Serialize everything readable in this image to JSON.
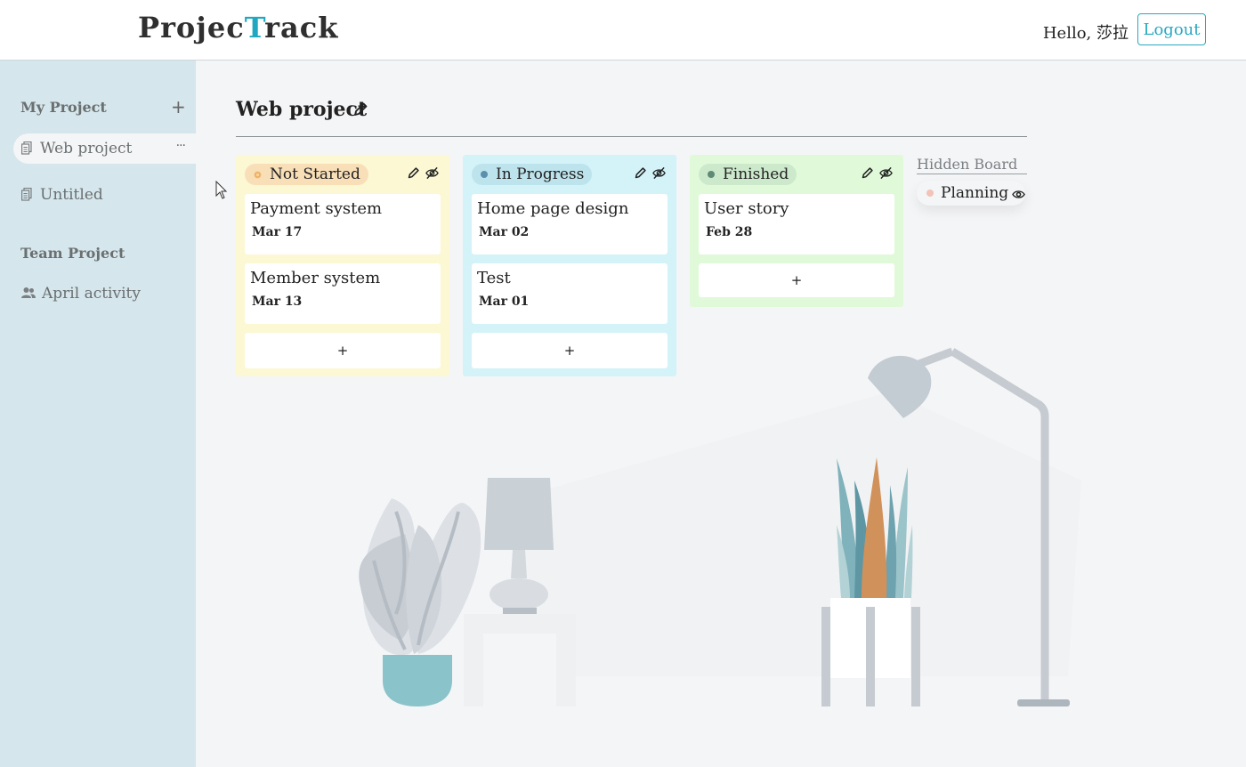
{
  "app": {
    "logo_part1": "Projec",
    "logo_accent": "T",
    "logo_part2": "rack",
    "accent_color": "#1fa8bf"
  },
  "header": {
    "greeting": "Hello, 莎拉",
    "logout_label": "Logout"
  },
  "sidebar": {
    "my_project_heading": "My Project",
    "add_icon": "+",
    "my_projects": [
      {
        "label": "Web project",
        "icon": "document-icon",
        "active": true,
        "more": "···"
      },
      {
        "label": "Untitled",
        "icon": "document-icon",
        "active": false
      }
    ],
    "team_project_heading": "Team Project",
    "team_projects": [
      {
        "label": "April activity",
        "icon": "users-icon"
      }
    ]
  },
  "main": {
    "project_title": "Web project",
    "boards": [
      {
        "status": "Not Started",
        "color": "#fbf8d3",
        "pill_color": "#f8dfb7",
        "dot_color": "#f2a64c",
        "cards": [
          {
            "title": "Payment system",
            "date": "Mar 17"
          },
          {
            "title": "Member system",
            "date": "Mar 13"
          }
        ],
        "add_label": "+"
      },
      {
        "status": "In Progress",
        "color": "#d3f3f8",
        "pill_color": "#bde3ec",
        "dot_color": "#5b8fae",
        "cards": [
          {
            "title": "Home page design",
            "date": "Mar 02"
          },
          {
            "title": "Test",
            "date": "Mar 01"
          }
        ],
        "add_label": "+"
      },
      {
        "status": "Finished",
        "color": "#e0fad9",
        "pill_color": "#cde9cc",
        "dot_color": "#5f8a75",
        "cards": [
          {
            "title": "User story",
            "date": "Feb 28"
          }
        ],
        "add_label": "+"
      }
    ],
    "hidden_board": {
      "heading": "Hidden Board",
      "items": [
        {
          "status": "Planning",
          "icon": "eye-icon"
        }
      ]
    }
  }
}
